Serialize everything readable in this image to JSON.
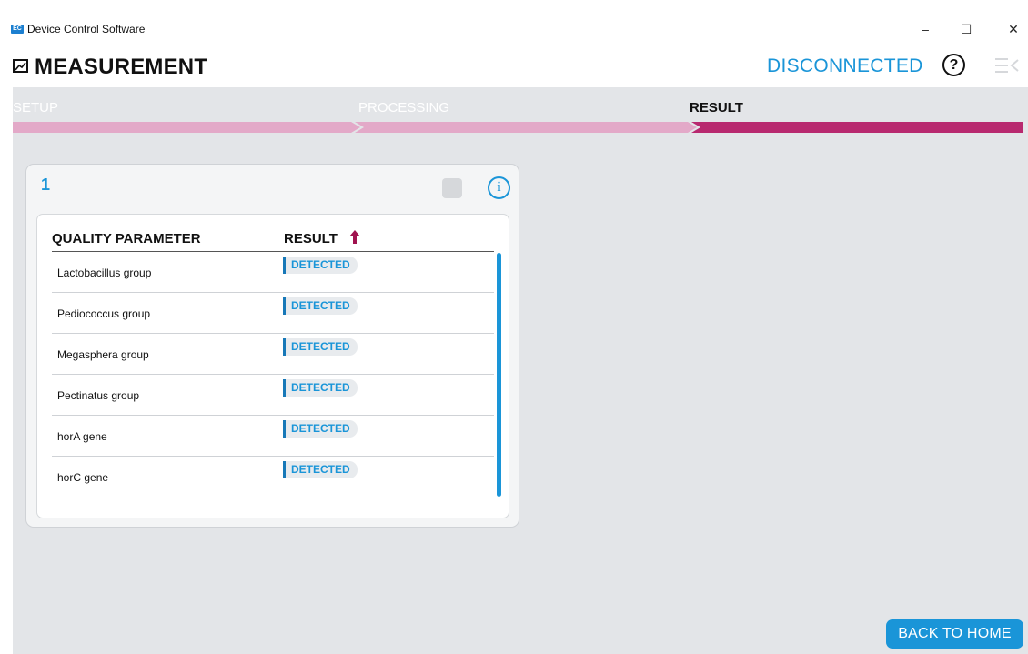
{
  "window": {
    "logo_text": "EC",
    "title": "Device Control Software",
    "minimize_glyph": "–",
    "maximize_glyph": "☐",
    "close_glyph": "✕"
  },
  "header": {
    "page_icon": "chart-icon",
    "title": "MEASUREMENT",
    "status": "DISCONNECTED",
    "help_glyph": "?",
    "menu_icon": "collapse-menu-icon"
  },
  "steps": [
    {
      "label": "SETUP",
      "state": "done"
    },
    {
      "label": "PROCESSING",
      "state": "done"
    },
    {
      "label": "RESULT",
      "state": "active"
    }
  ],
  "colors": {
    "accent": "#1a95d8",
    "step_done": "#e3a9c8",
    "step_active": "#b8296f",
    "sort_arrow": "#a0124f"
  },
  "card": {
    "number": "1",
    "info_glyph": "i",
    "columns": {
      "parameter": "QUALITY PARAMETER",
      "result": "RESULT"
    },
    "rows": [
      {
        "parameter": "Lactobacillus group",
        "result": "DETECTED"
      },
      {
        "parameter": "Pediococcus group",
        "result": "DETECTED"
      },
      {
        "parameter": "Megasphera group",
        "result": "DETECTED"
      },
      {
        "parameter": "Pectinatus group",
        "result": "DETECTED"
      },
      {
        "parameter": "horA gene",
        "result": "DETECTED"
      },
      {
        "parameter": "horC gene",
        "result": "DETECTED"
      }
    ]
  },
  "footer": {
    "back_label": "BACK TO HOME"
  }
}
